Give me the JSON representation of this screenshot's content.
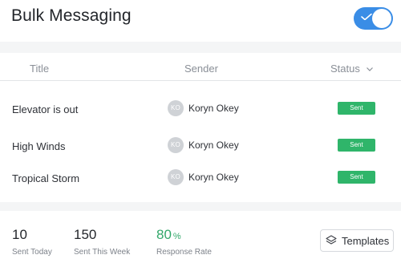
{
  "header": {
    "title": "Bulk Messaging",
    "toggle": {
      "on": true,
      "icon": "check-icon"
    }
  },
  "table": {
    "columns": {
      "title": "Title",
      "sender": "Sender",
      "status": "Status"
    },
    "rows": [
      {
        "title": "Elevator is out",
        "sender_initials": "KO",
        "sender": "Koryn Okey",
        "status": "Sent"
      },
      {
        "title": "High Winds",
        "sender_initials": "KO",
        "sender": "Koryn Okey",
        "status": "Sent"
      },
      {
        "title": "Tropical Storm",
        "sender_initials": "KO",
        "sender": "Koryn Okey",
        "status": "Sent"
      }
    ]
  },
  "stats": {
    "sent_today": {
      "value": "10",
      "label": "Sent Today"
    },
    "sent_week": {
      "value": "150",
      "label": "Sent This Week"
    },
    "response": {
      "value": "80",
      "unit": "%",
      "label": "Response Rate"
    }
  },
  "templates_button": {
    "label": "Templates",
    "icon": "layers-icon"
  },
  "colors": {
    "accent": "#3a8de6",
    "sent": "#2fb56a",
    "response": "#33a86b"
  }
}
